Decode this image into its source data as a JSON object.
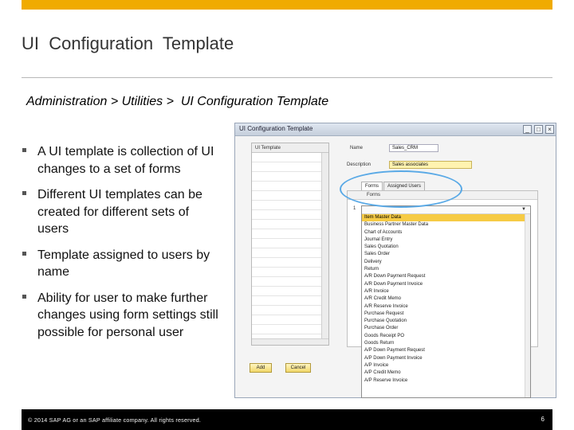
{
  "slide": {
    "title": "UI  Configuration  Template",
    "breadcrumb": "Administration > Utilities >  UI Configuration Template",
    "bullets": [
      "A UI template is collection of UI changes to a set of forms",
      "Different UI templates can be created for different sets of users",
      "Template assigned to users by name",
      "Ability for user to make further changes using form settings still possible for personal user"
    ],
    "footer": {
      "copyright": "© 2014 SAP AG or an SAP affiliate company. All rights reserved.",
      "page_number": "6"
    },
    "colors": {
      "accent_bar": "#f0ab00",
      "selected_item": "#f6cb45",
      "highlight_circle": "#59a9e6"
    }
  },
  "window": {
    "title": "UI Configuration Template",
    "controls": [
      "_",
      "□",
      "×"
    ],
    "template_list_header": "UI Template",
    "name_label": "Name",
    "name_value": "Sales_CRM",
    "description_label": "Description",
    "description_value": "Sales associates",
    "tabs": [
      "Forms",
      "Assigned Users"
    ],
    "forms_column_header": "Forms",
    "dropdown_row_number": "1",
    "dropdown_items": [
      "Item Master Data",
      "Business Partner Master Data",
      "Chart of Accounts",
      "Journal Entry",
      "Sales Quotation",
      "Sales Order",
      "Delivery",
      "Return",
      "A/R Down Payment Request",
      "A/R Down Payment Invoice",
      "A/R Invoice",
      "A/R Credit Memo",
      "A/R Reserve Invoice",
      "Purchase Request",
      "Purchase Quotation",
      "Purchase Order",
      "Goods Receipt PO",
      "Goods Return",
      "A/P Down Payment Request",
      "A/P Down Payment Invoice",
      "A/P Invoice",
      "A/P Credit Memo",
      "A/P Reserve Invoice"
    ],
    "add_button": "Add",
    "cancel_button": "Cancel"
  }
}
